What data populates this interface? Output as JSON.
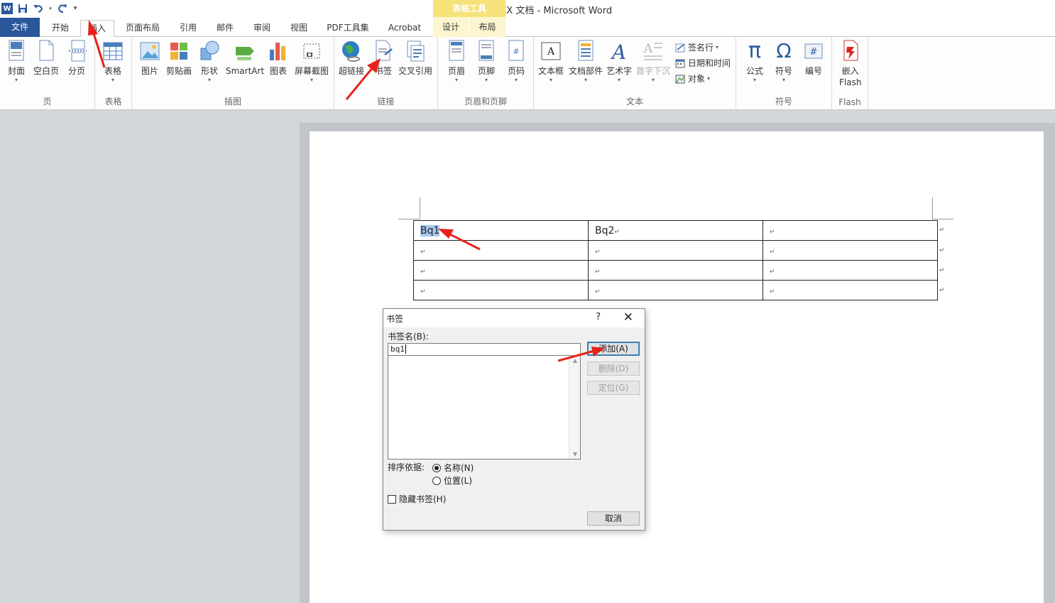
{
  "window": {
    "title": "新建 DOCX 文档 - Microsoft Word",
    "context_tab_group": "表格工具"
  },
  "qat": {
    "logo": "W",
    "icons": [
      "word-logo",
      "save-icon",
      "undo-icon",
      "redo-icon",
      "customize-qat-icon"
    ]
  },
  "tabs": {
    "file": "文件",
    "home": "开始",
    "insert": "插入",
    "page_layout": "页面布局",
    "references": "引用",
    "mailings": "邮件",
    "review": "审阅",
    "view": "视图",
    "pdf_tools": "PDF工具集",
    "acrobat": "Acrobat",
    "design": "设计",
    "layout": "布局"
  },
  "ribbon": {
    "groups": {
      "pages": "页",
      "tables": "表格",
      "illustrations": "插图",
      "links": "链接",
      "header_footer": "页眉和页脚",
      "text": "文本",
      "symbols": "符号",
      "flash": "Flash"
    },
    "buttons": {
      "cover": "封面",
      "blank_page": "空白页",
      "page_break": "分页",
      "table": "表格",
      "picture": "图片",
      "clip_art": "剪贴画",
      "shapes": "形状",
      "smartart": "SmartArt",
      "chart": "图表",
      "screenshot": "屏幕截图",
      "hyperlink": "超链接",
      "bookmark": "书签",
      "cross_ref": "交叉引用",
      "header": "页眉",
      "footer": "页脚",
      "page_number": "页码",
      "text_box": "文本框",
      "quick_parts": "文档部件",
      "wordart": "艺术字",
      "drop_cap": "首字下沉",
      "signature_line": "签名行",
      "date_time": "日期和时间",
      "object": "对象",
      "equation": "公式",
      "symbol": "符号",
      "numbering": "编号",
      "embed_flash_line1": "嵌入",
      "embed_flash_line2": "Flash"
    },
    "symbols": {
      "pi": "π",
      "omega": "Ω",
      "hash": "#"
    }
  },
  "document": {
    "table": [
      [
        "Bq1",
        "Bq2",
        ""
      ],
      [
        "",
        "",
        ""
      ],
      [
        "",
        "",
        ""
      ],
      [
        "",
        "",
        ""
      ]
    ],
    "para_mark": "↵",
    "selected_cell_text": "Bq1"
  },
  "dialog": {
    "title": "书签",
    "help": "?",
    "close": "✕",
    "name_label": "书签名(B):",
    "name_value": "bq1",
    "add_button": "添加(A)",
    "delete_button": "删除(D)",
    "goto_button": "定位(G)",
    "sort_label": "排序依据:",
    "sort_name": "名称(N)",
    "sort_location": "位置(L)",
    "sort_selected": "name",
    "hidden_label": "隐藏书签(H)",
    "hidden_checked": false,
    "cancel_button": "取消"
  },
  "colors": {
    "accent": "#2b579a",
    "annotation": "#e8221b",
    "context_tab": "#f7e27a",
    "selection": "#a9c8ef"
  }
}
